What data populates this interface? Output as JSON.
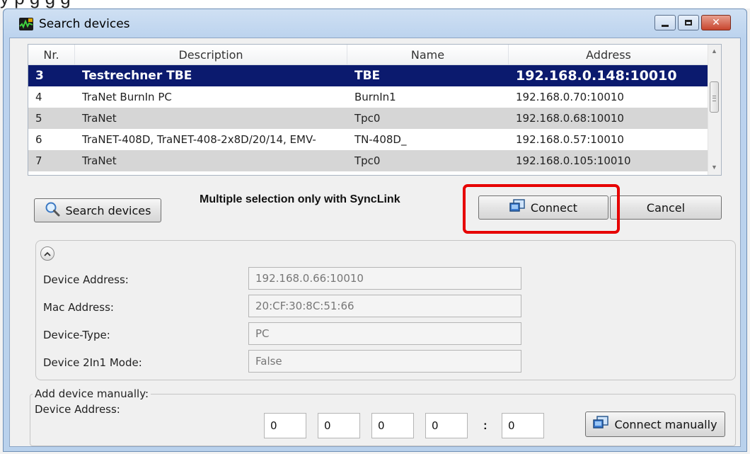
{
  "page": {
    "window_title": "Search devices",
    "top_text": "y                      p                  g g                         g"
  },
  "grid": {
    "columns": [
      "Nr.",
      "Description",
      "Name",
      "Address"
    ],
    "rows": [
      {
        "nr": "3",
        "description": "Testrechner TBE",
        "name": "TBE",
        "address": "192.168.0.148:10010",
        "selected": true
      },
      {
        "nr": "4",
        "description": "TraNet BurnIn PC",
        "name": "BurnIn1",
        "address": "192.168.0.70:10010"
      },
      {
        "nr": "5",
        "description": "TraNet",
        "name": "Tpc0",
        "address": "192.168.0.68:10010"
      },
      {
        "nr": "6",
        "description": "TraNET-408D, TraNET-408-2x8D/20/14, EMV-",
        "name": "TN-408D_",
        "address": "192.168.0.57:10010"
      },
      {
        "nr": "7",
        "description": "TraNet",
        "name": "Tpc0",
        "address": "192.168.0.105:10010"
      }
    ]
  },
  "buttons": {
    "search": "Search devices",
    "connect": "Connect",
    "cancel": "Cancel",
    "connect_manually": "Connect manually"
  },
  "multi_note": "Multiple selection only with SyncLink",
  "details": {
    "device_address_label": "Device Address:",
    "device_address": "192.168.0.66:10010",
    "mac_label": "Mac Address:",
    "mac": "20:CF:30:8C:51:66",
    "type_label": "Device-Type:",
    "type": "PC",
    "mode_label": "Device 2In1 Mode:",
    "mode": "False"
  },
  "manual": {
    "legend": "Add device manually:",
    "address_label": "Device Address:",
    "octets": [
      "0",
      "0",
      "0",
      "0"
    ],
    "port": "0",
    "separator": ":"
  },
  "icons": [
    "app-icon",
    "magnifier-icon",
    "connect-icon",
    "minimize-icon",
    "maximize-icon",
    "close-icon",
    "chevron-up-icon"
  ],
  "colors": {
    "selection": "#0b1a6e",
    "highlight": "#e60000"
  }
}
